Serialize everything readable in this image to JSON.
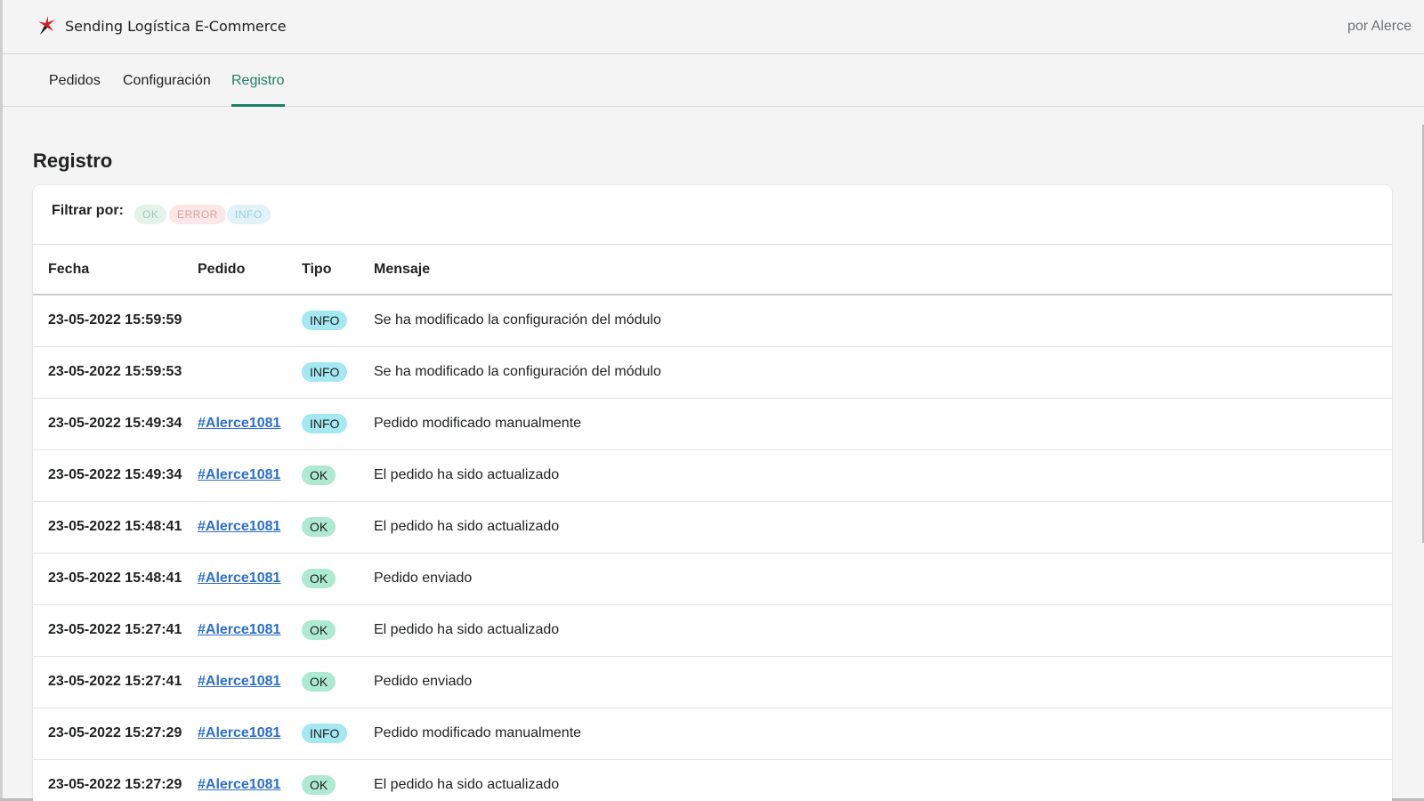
{
  "header": {
    "app_title": "Sending Logística E-Commerce",
    "by_line": "por Alerce"
  },
  "tabs": [
    {
      "label": "Pedidos",
      "active": false
    },
    {
      "label": "Configuración",
      "active": false
    },
    {
      "label": "Registro",
      "active": true
    }
  ],
  "page": {
    "title": "Registro"
  },
  "filters": {
    "label": "Filtrar por:",
    "chips": [
      "OK",
      "ERROR",
      "INFO"
    ]
  },
  "table": {
    "columns": [
      "Fecha",
      "Pedido",
      "Tipo",
      "Mensaje"
    ],
    "rows": [
      {
        "fecha": "23-05-2022 15:59:59",
        "pedido": "",
        "tipo": "INFO",
        "mensaje": "Se ha modificado la configuración del módulo"
      },
      {
        "fecha": "23-05-2022 15:59:53",
        "pedido": "",
        "tipo": "INFO",
        "mensaje": "Se ha modificado la configuración del módulo"
      },
      {
        "fecha": "23-05-2022 15:49:34",
        "pedido": "#Alerce1081",
        "tipo": "INFO",
        "mensaje": "Pedido modificado manualmente"
      },
      {
        "fecha": "23-05-2022 15:49:34",
        "pedido": "#Alerce1081",
        "tipo": "OK",
        "mensaje": "El pedido ha sido actualizado"
      },
      {
        "fecha": "23-05-2022 15:48:41",
        "pedido": "#Alerce1081",
        "tipo": "OK",
        "mensaje": "El pedido ha sido actualizado"
      },
      {
        "fecha": "23-05-2022 15:48:41",
        "pedido": "#Alerce1081",
        "tipo": "OK",
        "mensaje": "Pedido enviado"
      },
      {
        "fecha": "23-05-2022 15:27:41",
        "pedido": "#Alerce1081",
        "tipo": "OK",
        "mensaje": "El pedido ha sido actualizado"
      },
      {
        "fecha": "23-05-2022 15:27:41",
        "pedido": "#Alerce1081",
        "tipo": "OK",
        "mensaje": "Pedido enviado"
      },
      {
        "fecha": "23-05-2022 15:27:29",
        "pedido": "#Alerce1081",
        "tipo": "INFO",
        "mensaje": "Pedido modificado manualmente"
      },
      {
        "fecha": "23-05-2022 15:27:29",
        "pedido": "#Alerce1081",
        "tipo": "OK",
        "mensaje": "El pedido ha sido actualizado"
      }
    ]
  },
  "colors": {
    "accent": "#1e7f64",
    "link": "#2c6ecb",
    "info_badge": "#a4e8f2",
    "ok_badge": "#aee9d1"
  },
  "icons": {
    "logo": "sending-logo-icon"
  }
}
